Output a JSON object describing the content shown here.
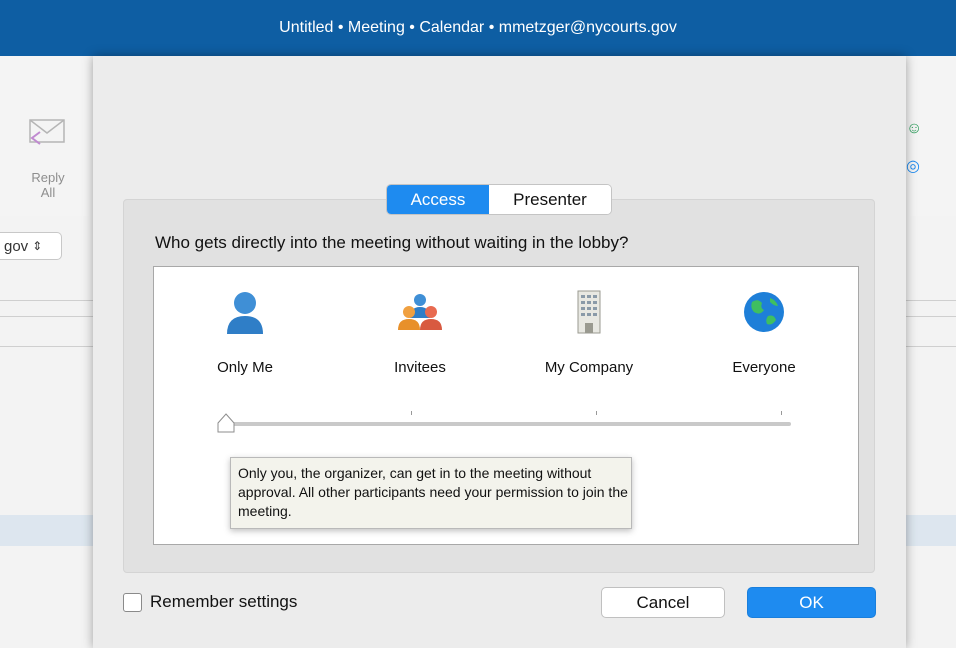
{
  "window": {
    "title": "Untitled • Meeting • Calendar • mmetzger@nycourts.gov"
  },
  "background": {
    "reply_all_label": "Reply All",
    "account_select_value": "gov"
  },
  "dialog": {
    "tabs": [
      {
        "label": "Access",
        "selected": true
      },
      {
        "label": "Presenter",
        "selected": false
      }
    ],
    "question": "Who gets directly into the meeting without waiting in the lobby?",
    "options": [
      {
        "label": "Only Me",
        "icon": "person-icon"
      },
      {
        "label": "Invitees",
        "icon": "people-group-icon"
      },
      {
        "label": "My Company",
        "icon": "building-icon"
      },
      {
        "label": "Everyone",
        "icon": "globe-icon"
      }
    ],
    "slider": {
      "selected_index": 0,
      "steps": 4
    },
    "tooltip": "Only you, the organizer, can get in to the meeting without approval. All other participants need your permission to join the meeting.",
    "remember_label": "Remember settings",
    "remember_checked": false,
    "cancel_label": "Cancel",
    "ok_label": "OK"
  },
  "colors": {
    "accent": "#1e8bf0",
    "titlebar": "#0e5ea3"
  }
}
